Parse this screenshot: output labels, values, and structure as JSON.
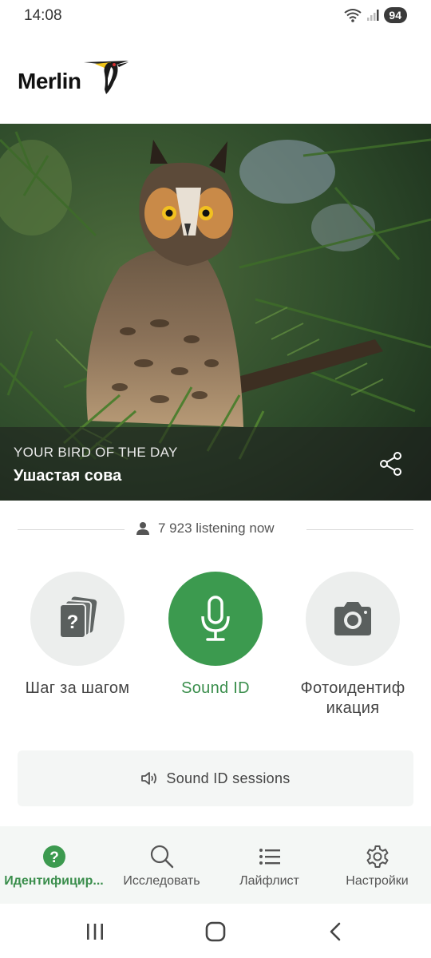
{
  "status": {
    "time": "14:08",
    "battery": "94"
  },
  "app": {
    "logo_text": "Merlin"
  },
  "bird_of_day": {
    "kicker": "YOUR BIRD OF THE DAY",
    "name": "Ушастая сова"
  },
  "listening": {
    "count_text": "7 923 listening now"
  },
  "options": {
    "step": {
      "label": "Шаг за шагом"
    },
    "sound": {
      "label": "Sound ID"
    },
    "photo": {
      "label_line1": "Фотоидентиф",
      "label_line2": "икация"
    }
  },
  "sessions": {
    "label": "Sound ID sessions"
  },
  "bottom_nav": [
    {
      "label": "Идентифицир...",
      "icon": "help-circle-icon",
      "active": true
    },
    {
      "label": "Исследовать",
      "icon": "search-icon",
      "active": false
    },
    {
      "label": "Лайфлист",
      "icon": "list-icon",
      "active": false
    },
    {
      "label": "Настройки",
      "icon": "gear-icon",
      "active": false
    }
  ],
  "colors": {
    "accent_green": "#3c9a4f",
    "bottom_nav_bg": "#f4f7f5"
  }
}
